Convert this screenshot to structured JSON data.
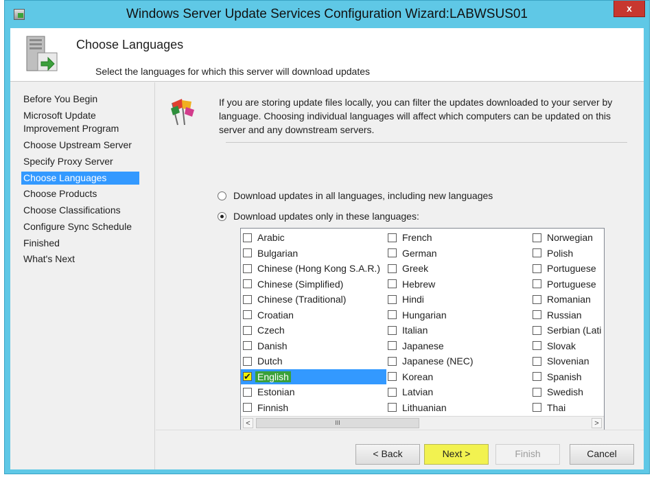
{
  "window": {
    "title": "Windows Server Update Services Configuration Wizard:LABWSUS01",
    "close_label": "x"
  },
  "header": {
    "title": "Choose Languages",
    "subtitle": "Select the languages for which this server will download updates"
  },
  "sidebar": {
    "items": [
      {
        "label": "Before You Begin"
      },
      {
        "label": "Microsoft Update\nImprovement Program"
      },
      {
        "label": "Choose Upstream Server"
      },
      {
        "label": "Specify Proxy Server"
      },
      {
        "label": "Choose Languages",
        "active": true
      },
      {
        "label": "Choose Products"
      },
      {
        "label": "Choose Classifications"
      },
      {
        "label": "Configure Sync Schedule"
      },
      {
        "label": "Finished"
      },
      {
        "label": "What's Next"
      }
    ]
  },
  "main": {
    "description": "If you are storing update files locally, you can filter the updates downloaded to your server by language. Choosing individual languages will affect which computers can be updated on this server and any downstream servers.",
    "radio_all": {
      "label": "Download updates in all languages, including new languages",
      "selected": false
    },
    "radio_only": {
      "label": "Download updates only in these languages:",
      "selected": true
    },
    "languages": {
      "col1": [
        "Arabic",
        "Bulgarian",
        "Chinese (Hong Kong S.A.R.)",
        "Chinese (Simplified)",
        "Chinese (Traditional)",
        "Croatian",
        "Czech",
        "Danish",
        "Dutch",
        "English",
        "Estonian",
        "Finnish"
      ],
      "col2": [
        "French",
        "German",
        "Greek",
        "Hebrew",
        "Hindi",
        "Hungarian",
        "Italian",
        "Japanese",
        "Japanese (NEC)",
        "Korean",
        "Latvian",
        "Lithuanian"
      ],
      "col3": [
        "Norwegian",
        "Polish",
        "Portuguese",
        "Portuguese",
        "Romanian",
        "Russian",
        "Serbian (Lati",
        "Slovak",
        "Slovenian",
        "Spanish",
        "Swedish",
        "Thai"
      ],
      "checked": [
        "English"
      ]
    },
    "scroll_thumb_label": "III"
  },
  "buttons": {
    "back": "< Back",
    "next": "Next >",
    "finish": "Finish",
    "cancel": "Cancel"
  }
}
